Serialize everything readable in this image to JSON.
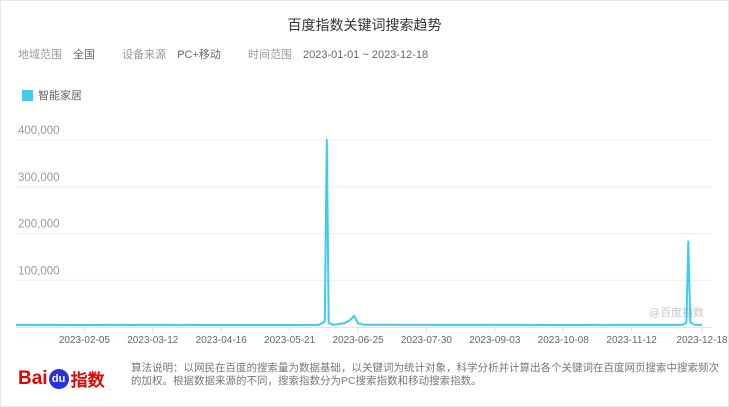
{
  "title": "百度指数关键词搜索趋势",
  "filters": {
    "region_label": "地域范围",
    "region_value": "全国",
    "device_label": "设备来源",
    "device_value": "PC+移动",
    "time_label": "时间范围",
    "time_value": "2023-01-01 ~ 2023-12-18"
  },
  "watermark": "@百度指数",
  "footer": {
    "logo_bai": "Bai",
    "logo_du": "du",
    "logo_index": "指数",
    "note": "算法说明：以网民在百度的搜索量为数据基础，以关键词为统计对象，科学分析并计算出各个关键词在百度网页搜索中搜索频次的加权。根据数据来源的不同，搜索指数分为PC搜索指数和移动搜索指数。"
  },
  "colors": {
    "series": "#3ecbf0",
    "grid": "#eeeeee",
    "axis_text": "#999999"
  },
  "chart_data": {
    "type": "line",
    "legend_position": "top-left",
    "grid": true,
    "ylim": [
      0,
      400000
    ],
    "yticks": [
      "100,000",
      "200,000",
      "300,000",
      "400,000"
    ],
    "ytick_values": [
      100000,
      200000,
      300000,
      400000
    ],
    "xlim": [
      "2023-01-01",
      "2023-12-18"
    ],
    "xticks": [
      "2023-02-05",
      "2023-03-12",
      "2023-04-16",
      "2023-05-21",
      "2023-06-25",
      "2023-07-30",
      "2023-09-03",
      "2023-10-08",
      "2023-11-12",
      "2023-12-18"
    ],
    "series": [
      {
        "name": "智能家居",
        "color": "#3ecbf0",
        "points": [
          [
            "2023-01-01",
            4500
          ],
          [
            "2023-02-05",
            4300
          ],
          [
            "2023-03-12",
            4400
          ],
          [
            "2023-04-16",
            4200
          ],
          [
            "2023-05-21",
            4300
          ],
          [
            "2023-06-05",
            4500
          ],
          [
            "2023-06-08",
            12000
          ],
          [
            "2023-06-09",
            400000
          ],
          [
            "2023-06-10",
            9000
          ],
          [
            "2023-06-12",
            4500
          ],
          [
            "2023-06-18",
            8000
          ],
          [
            "2023-06-21",
            15000
          ],
          [
            "2023-06-23",
            24000
          ],
          [
            "2023-06-25",
            8000
          ],
          [
            "2023-06-28",
            5000
          ],
          [
            "2023-07-30",
            4500
          ],
          [
            "2023-09-03",
            4400
          ],
          [
            "2023-10-08",
            4300
          ],
          [
            "2023-11-12",
            4400
          ],
          [
            "2023-12-08",
            4500
          ],
          [
            "2023-12-10",
            9000
          ],
          [
            "2023-12-11",
            183000
          ],
          [
            "2023-12-12",
            10000
          ],
          [
            "2023-12-14",
            5000
          ],
          [
            "2023-12-18",
            4500
          ]
        ]
      }
    ]
  }
}
